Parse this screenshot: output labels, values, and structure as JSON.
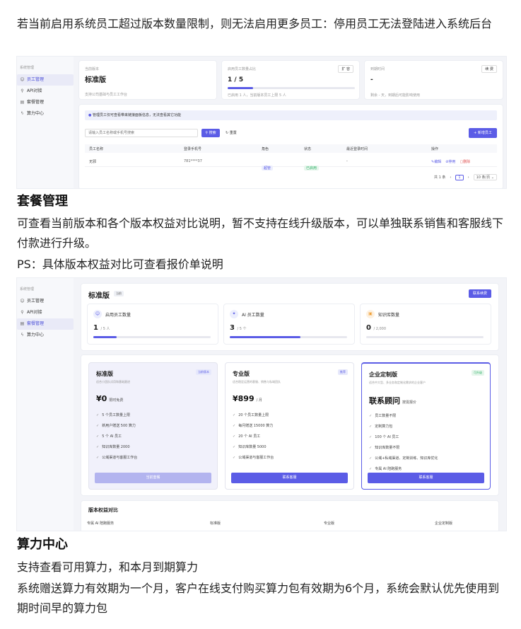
{
  "doc": {
    "para_limit": "若当前启用系统员工超过版本数量限制，则无法启用更多员工：停用员工无法登陆进入系统后台",
    "heading_plan": "套餐管理",
    "para_plan": "可查看当前版本和各个版本权益对比说明，暂不支持在线升级版本，可以单独联系销售和客服线下付款进行升级。",
    "para_ps": "PS：具体版本权益对比可查看报价单说明",
    "heading_compute": "算力中心",
    "para_compute1": "支持查看可用算力，和本月到期算力",
    "para_compute2": "系统赠送算力有效期为一个月，客户在线支付购买算力包有效期为6个月，系统会默认优先使用到期时间早的算力包"
  },
  "shot1": {
    "sidebar": {
      "title": "系统管理",
      "items": [
        {
          "icon": "user-icon",
          "glyph": "☺",
          "label": "员工管理"
        },
        {
          "icon": "link-icon",
          "glyph": "⚲",
          "label": "API对接"
        },
        {
          "icon": "package-icon",
          "glyph": "▤",
          "label": "套餐管理"
        },
        {
          "icon": "bolt-icon",
          "glyph": "ϟ",
          "label": "算力中心"
        }
      ]
    },
    "version_card": {
      "label": "当前版本",
      "value": "标准版",
      "desc": "支持公司基础与员工工作台"
    },
    "quota_card": {
      "label": "启用员工数量占比",
      "button": "扩 容",
      "value": "1 / 5",
      "progress": 0.2,
      "desc": "已启用 1 人，当前版本员工上限 5 人"
    },
    "expire_card": {
      "label": "到期时间",
      "button": "续 费",
      "value": "-",
      "desc": "剩余 - 天，到期后可能影响使用"
    },
    "notice": "管理员工仅可查看带来链接面板信息，无法查看其它功能",
    "search_placeholder": "请输入员工名称或手机号搜索",
    "search_button": "搜索",
    "reset_button": "重置",
    "add_button": "+ 新增员工",
    "columns": [
      "员工名称",
      "登录手机号",
      "角色",
      "状态",
      "最近登录时间",
      "操作"
    ],
    "rows": [
      {
        "name": "无邪",
        "phone": "781****37",
        "role": "超管",
        "status": "已启用",
        "last_login": "-",
        "actions": [
          "编辑",
          "停用",
          "删除"
        ]
      }
    ],
    "pager": {
      "total": "共 1 条",
      "page": "1",
      "size": "10 条/页"
    }
  },
  "shot2": {
    "sidebar": {
      "title": "系统管理",
      "items": [
        {
          "icon": "user-icon",
          "glyph": "☺",
          "label": "员工管理"
        },
        {
          "icon": "link-icon",
          "glyph": "⚲",
          "label": "API对接"
        },
        {
          "icon": "package-icon",
          "glyph": "▤",
          "label": "套餐管理"
        },
        {
          "icon": "bolt-icon",
          "glyph": "ϟ",
          "label": "算力中心"
        }
      ]
    },
    "current_plan": "标准版",
    "current_badge": "当前",
    "contact_button": "联系续费",
    "stats": [
      {
        "icon": "people-icon",
        "glyph": "☺",
        "label": "启用员工数量",
        "value": "1",
        "unit": "/ 5 人",
        "progress": 0.2,
        "color": "#5b5ce6"
      },
      {
        "icon": "ai-icon",
        "glyph": "✦",
        "label": "AI 员工数量",
        "value": "3",
        "unit": "/ 5 个",
        "progress": 0.6,
        "color": "#5b5ce6"
      },
      {
        "icon": "book-icon",
        "glyph": "▣",
        "label": "知识库数量",
        "value": "0",
        "unit": "/ 2,000",
        "progress": 0,
        "color": "#f0a23b"
      }
    ],
    "plans": [
      {
        "name": "标准版",
        "badge": "当前版本",
        "desc": "适合小团队试用和基础跟进",
        "price": "¥0",
        "price_note": "限时免费",
        "features": [
          "5 个员工数量上限",
          "新用户赠送 500 算力",
          "5 个 AI 员工",
          "知识库数量 2000",
          "公域渠道与客服工作台"
        ],
        "button": "当前套餐"
      },
      {
        "name": "专业版",
        "badge": "推荐",
        "desc": "适合稳定运营的客服、销售与私域团队",
        "price": "¥899",
        "price_note": "/ 月",
        "features": [
          "20 个员工数量上限",
          "每月赠送 15000 算力",
          "20 个 AI 员工",
          "知识库数量 5000",
          "公域渠道与客服工作台"
        ],
        "button": "联系客服"
      },
      {
        "name": "企业定制版",
        "badge": "可升级",
        "desc": "适合中大型、多业务和定制化需求的企业客户",
        "price": "联系顾问",
        "price_note": "按需报价",
        "features": [
          "员工数量不限",
          "定制算力包",
          "100 个 AI 员工",
          "知识库数量不限",
          "公域+私域渠道、定制训练、知识库优化",
          "专属 AI 陪跑服务"
        ],
        "button": "联系客服"
      }
    ],
    "compare_title": "版本权益对比",
    "compare_columns": [
      "专属 AI 陪跑服务",
      "标准版",
      "专业版",
      "企业定制版"
    ]
  },
  "colors": {
    "accent": "#5b5ce6",
    "green": "#34b36b",
    "orange": "#f0a23b"
  }
}
